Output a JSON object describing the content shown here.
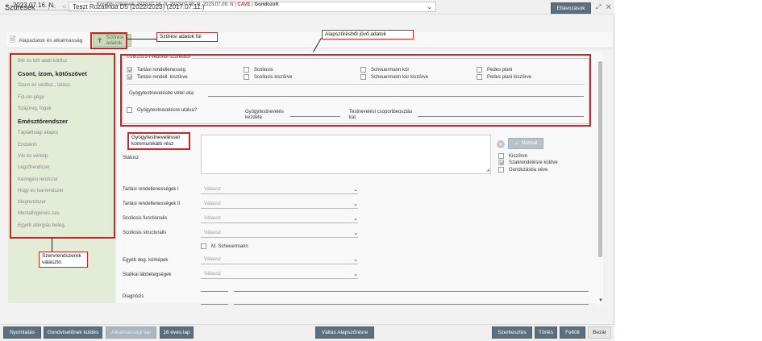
{
  "window": {
    "app_title": "Szűrések",
    "nav_arrows": "|< < > >|",
    "patient": "Teszt Rozalinda D5 (2022/2023) (2017.07.11.)",
    "leave_button": "Eltávozások",
    "window_icons": "⤢ ✕",
    "accent_color": "#5b6f7f"
  },
  "datebar": {
    "date_value": "2023.07.16. N",
    "previous_label": "Korábbi szűrések:",
    "previous_dates": "2023.07.16. N, 2023.07.09. N, 2023.07.09. N",
    "cave": "CAVE",
    "gondozott": "Gondozott"
  },
  "tabs": [
    {
      "label": "Alapadatok és alkalmasság",
      "icon": "document-icon"
    },
    {
      "label": "Szűrési adatok",
      "icon": "person-icon"
    }
  ],
  "sidebar": {
    "items": [
      {
        "label": "Bőr és bőr alatti kötősz.",
        "bold": false
      },
      {
        "label": "Csont, izom, kötőszövet",
        "bold": true
      },
      {
        "label": "Szem és védősz., látász.",
        "bold": false
      },
      {
        "label": "Fül-orr-gége",
        "bold": false
      },
      {
        "label": "Szájüreg, fogak",
        "bold": false
      },
      {
        "label": "Emésztőrendszer",
        "bold": true
      },
      {
        "label": "Táplálttsági állapot",
        "bold": false
      },
      {
        "label": "Endokrin",
        "bold": false
      },
      {
        "label": "Vér és vérkép.",
        "bold": false
      },
      {
        "label": "Légzőrendszer",
        "bold": false
      },
      {
        "label": "Keringési rendszer",
        "bold": false
      },
      {
        "label": "Húgy és ivarrendszer",
        "bold": false
      },
      {
        "label": "Idegrendszer",
        "bold": false
      },
      {
        "label": "Mentálhigiénés zav.",
        "bold": false
      },
      {
        "label": "Egyéb allergiás beteg.",
        "bold": false
      }
    ]
  },
  "vedonoi": {
    "legend": "7/16/2023-i védőnői szűrésből",
    "checkboxes": [
      {
        "label": "Tartási rendellenesség",
        "checked": true
      },
      {
        "label": "Tartási rendell. kiszűrve",
        "checked": true
      },
      {
        "label": "Scoliosis",
        "checked": false
      },
      {
        "label": "Scoliosis kiszűrve",
        "checked": false
      },
      {
        "label": "Scheuermann kór",
        "checked": false
      },
      {
        "label": "Scheuermann kór kiszűrve",
        "checked": false
      },
      {
        "label": "Pedes plani",
        "checked": false
      },
      {
        "label": "Pedes plani kiszűrve",
        "checked": false
      }
    ],
    "vetel_oka": "Gyógytestnevelésbe vétel oka",
    "utalva": "Gyógytestnevelésre utalva?",
    "kezdete": "Gyógytestnevelés kezdete",
    "csoport": "Testnevelési csoportbeosztás kat."
  },
  "form": {
    "status_label": "Státusz",
    "normal_button": "Normál",
    "right_checkboxes": [
      {
        "label": "Kiszűrve",
        "checked": false
      },
      {
        "label": "Szakrendelésre küldve",
        "checked": true
      },
      {
        "label": "Gondozásba véve",
        "checked": false
      }
    ],
    "dropdowns": [
      {
        "label": "Tartási rendellenességek I",
        "value": "Válassz"
      },
      {
        "label": "Tartási rendellenességek II",
        "value": "Válassz"
      },
      {
        "label": "Scoliosis functionalis",
        "value": "Válassz"
      },
      {
        "label": "Scoliosis structuralis",
        "value": "Válassz"
      }
    ],
    "scheuermann": "M. Scheuermann",
    "dropdowns2": [
      {
        "label": "Egyéb deg. kórképek",
        "value": "Válassz"
      },
      {
        "label": "Statikai lábbetegségek",
        "value": "Válassz"
      }
    ],
    "diagnozis": "Diagnózis"
  },
  "bottom": {
    "print": "Nyomtatás",
    "gondviselo": "Gondviselőnek küldés",
    "alkalmassagi": "Alkalmassági lap",
    "tizenhat": "16 éves lap",
    "valtas": "Váltás Alapszűrésre",
    "edit": "Szerkesztés",
    "delete": "Törlés",
    "upload": "Feltölt",
    "close": "Bezár"
  },
  "annotations": {
    "tab_label": "Szűrési adatok fül",
    "alap_label": "Alapszűrésből jövő adatok",
    "gyogy_label": "Gyógytestneveléssel kommunikáló rész",
    "szerv_label": "Szervrendszerek választó",
    "color": "#c62828"
  }
}
